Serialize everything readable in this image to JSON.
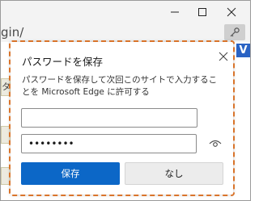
{
  "browser": {
    "address_text": "gin/",
    "edge_block_text": "V",
    "edge_strip_text": "タ"
  },
  "window_controls": {
    "minimize_icon": "minimize-icon",
    "maximize_icon": "maximize-icon",
    "close_icon": "close-icon"
  },
  "dialog": {
    "title": "パスワードを保存",
    "description": "パスワードを保存して次回このサイトで入力することを Microsoft Edge に許可する",
    "username_value": "",
    "password_value": "••••••••",
    "save_label": "保存",
    "no_label": "なし",
    "close_icon": "close-icon",
    "reveal_icon": "eye-icon"
  },
  "colors": {
    "accent_blue": "#0c67c7",
    "highlight_outline": "#d9742b"
  }
}
